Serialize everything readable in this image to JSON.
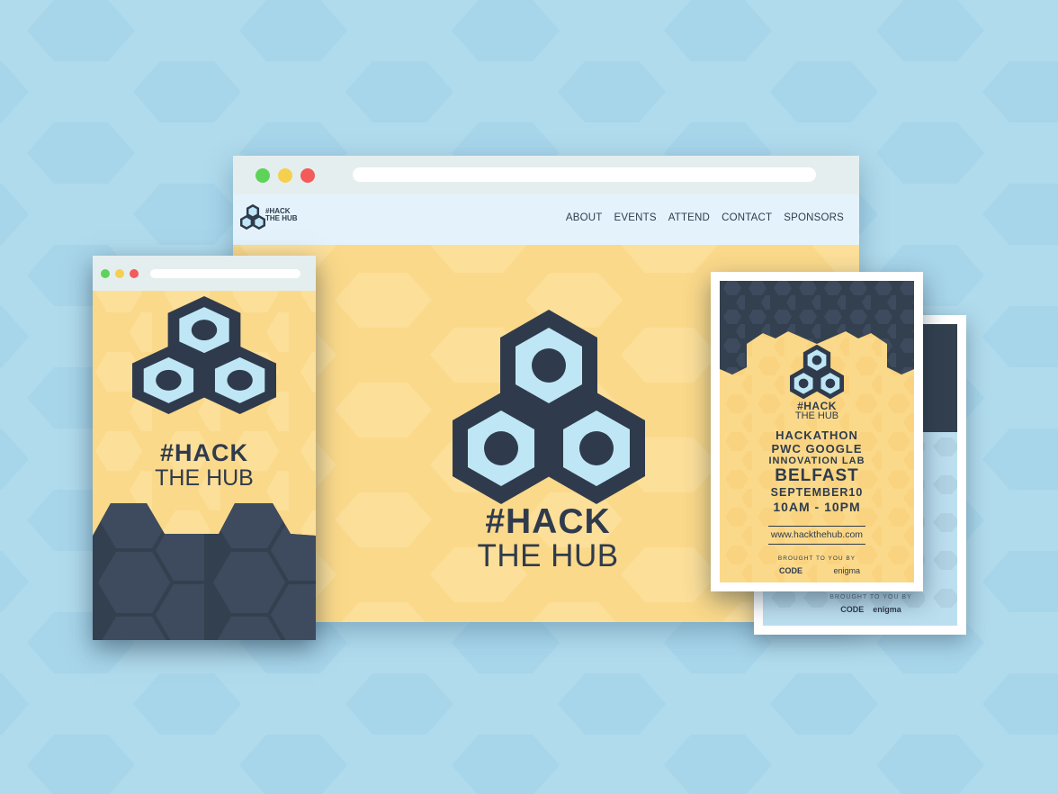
{
  "colors": {
    "background": "#b0dbed",
    "honey": "#fbd98a",
    "navy": "#2f3b4d",
    "ice": "#bfe6f5",
    "dot_green": "#5ed35a",
    "dot_yellow": "#f5d04f",
    "dot_red": "#f35a5a"
  },
  "desktop": {
    "nav": {
      "logo_line1": "#HACK",
      "logo_line2": "THE HUB",
      "links": [
        "ABOUT",
        "EVENTS",
        "ATTEND",
        "CONTACT",
        "SPONSORS"
      ]
    },
    "hero": {
      "title_line1": "#HACK",
      "title_line2": "THE HUB"
    }
  },
  "mobile": {
    "title_line1": "#HACK",
    "title_line2": "THE HUB"
  },
  "poster": {
    "logo_line1": "#HACK",
    "logo_line2": "THE HUB",
    "event": "HACKATHON",
    "venue_line1": "PWC GOOGLE",
    "venue_line2": "INNOVATION LAB",
    "city": "BELFAST",
    "date": "SEPTEMBER10",
    "time": "10AM - 10PM",
    "url": "www.hackthehub.com",
    "brought_by": "BROUGHT TO YOU BY",
    "sponsor1": "CODE",
    "sponsor2": "enigma"
  },
  "poster_back": {
    "brought_by": "BROUGHT TO YOU BY",
    "sponsor1": "CODE",
    "sponsor2": "enigma"
  }
}
